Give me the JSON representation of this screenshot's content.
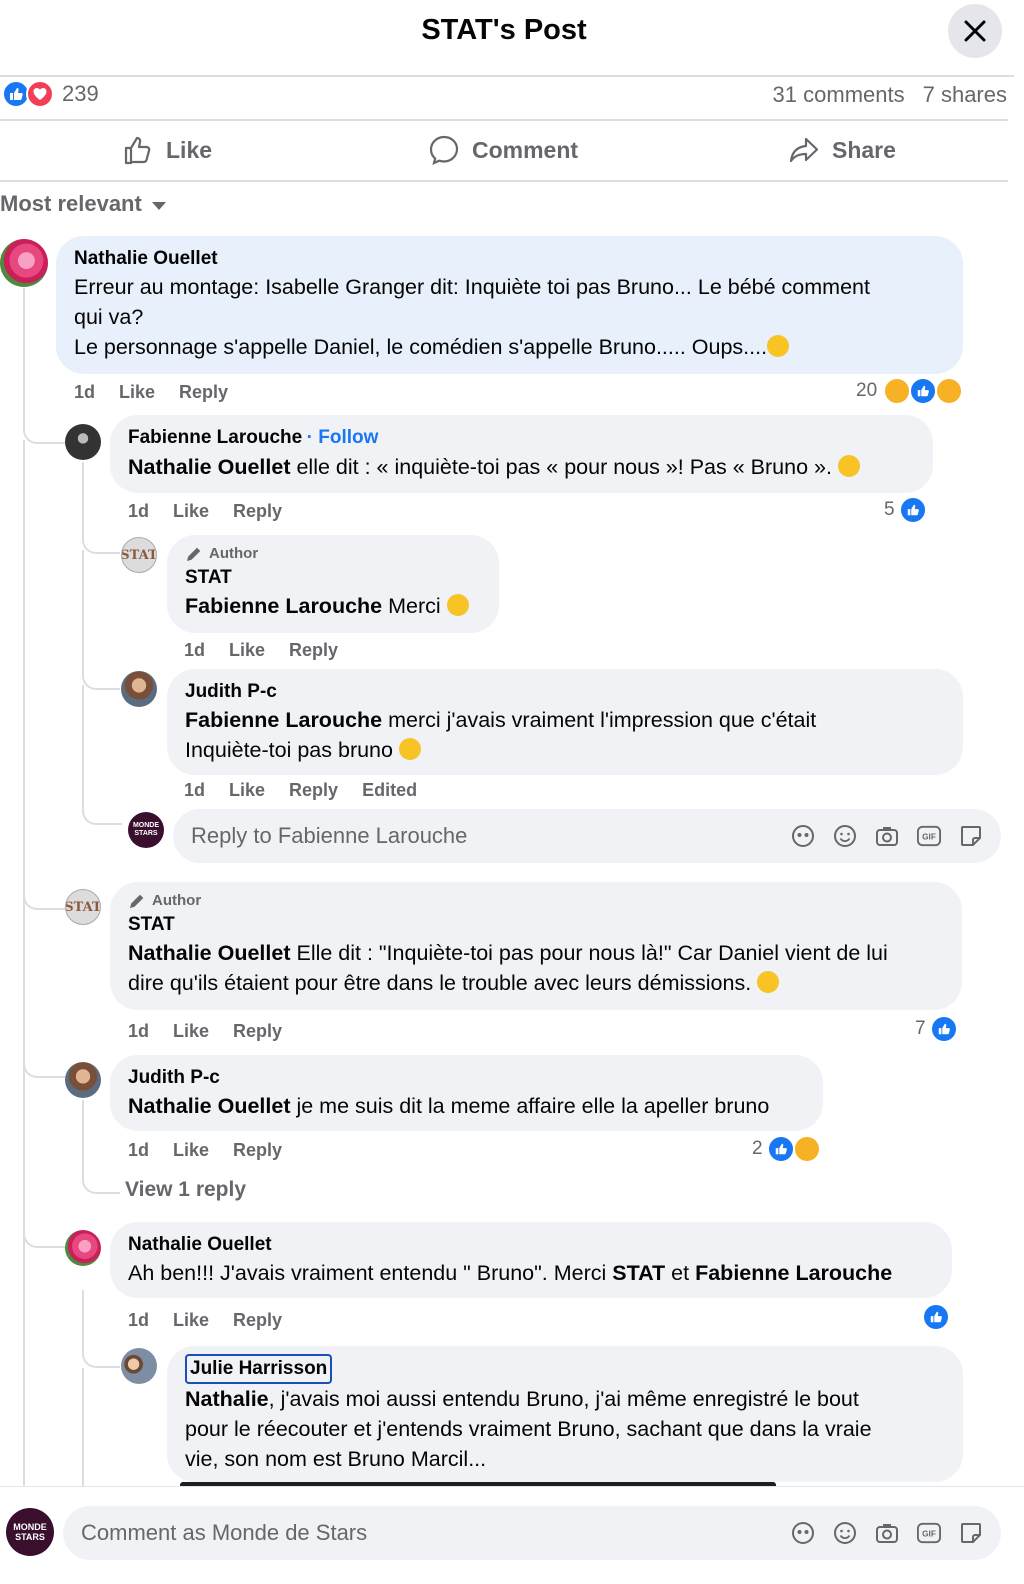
{
  "header": {
    "title": "STAT's Post"
  },
  "stats": {
    "reactions": "239",
    "comments": "31 comments",
    "shares": "7 shares"
  },
  "actions": {
    "like": "Like",
    "comment": "Comment",
    "share": "Share"
  },
  "sort": {
    "label": "Most relevant"
  },
  "colors": {
    "accent": "#1877f2",
    "bubble": "#f0f2f5",
    "bubble_highlight": "#e7f0fb",
    "secondary_text": "#65676b",
    "love": "#f33e58"
  },
  "comments": [
    {
      "author": "Nathalie Ouellet",
      "text1": "Erreur au montage: Isabelle Granger dit: Inquiète toi pas Bruno... Le bébé comment",
      "text2": "qui va?",
      "text3": "Le personnage s'appelle Daniel, le comédien s'appelle Bruno..... Oups....",
      "time": "1d",
      "like": "Like",
      "reply": "Reply",
      "reaction_count": "20"
    },
    {
      "author": "Fabienne Larouche",
      "follow": "· Follow",
      "mention": "Nathalie Ouellet",
      "text": " elle dit : « inquiète-toi pas « pour nous »! Pas « Bruno ».",
      "time": "1d",
      "like": "Like",
      "reply": "Reply",
      "reaction_count": "5"
    },
    {
      "badge": "Author",
      "author": "STAT",
      "mention": "Fabienne Larouche",
      "text": " Merci",
      "time": "1d",
      "like": "Like",
      "reply": "Reply"
    },
    {
      "author": "Judith P-c",
      "mention": "Fabienne Larouche",
      "text1": " merci j'avais vraiment l'impression que c'était",
      "text2": "Inquiète-toi pas bruno",
      "time": "1d",
      "like": "Like",
      "reply": "Reply",
      "edited": "Edited"
    },
    {
      "badge": "Author",
      "author": "STAT",
      "mention": "Nathalie Ouellet",
      "text1": " Elle dit : \"Inquiète-toi pas pour nous là!\" Car Daniel vient de lui",
      "text2": "dire qu'ils étaient pour être dans le trouble avec leurs démissions.",
      "time": "1d",
      "like": "Like",
      "reply": "Reply",
      "reaction_count": "7"
    },
    {
      "author": "Judith P-c",
      "mention": "Nathalie Ouellet",
      "text": " je me suis dit la meme affaire elle la apeller bruno",
      "time": "1d",
      "like": "Like",
      "reply": "Reply",
      "reaction_count": "2",
      "view_replies": "View 1 reply"
    },
    {
      "author": "Nathalie Ouellet",
      "text_a": "Ah ben!!! J'avais vraiment entendu \" Bruno\". Merci ",
      "mention1": "STAT",
      "text_b": " et ",
      "mention2": "Fabienne Larouche",
      "time": "1d",
      "like": "Like",
      "reply": "Reply"
    },
    {
      "author": "Julie Harrisson",
      "mention": "Nathalie",
      "text1": ", j'avais moi aussi entendu Bruno, j'ai même enregistré le bout",
      "text2": "pour le réecouter et j'entends vraiment Bruno, sachant que dans la vraie",
      "text3": "vie, son nom est Bruno Marcil..."
    }
  ],
  "reply_box": {
    "placeholder": "Reply to Fabienne Larouche",
    "avatar_text": "MONDE STARS"
  },
  "comment_box": {
    "placeholder": "Comment as Monde de Stars",
    "avatar_text": "MONDE STARS"
  },
  "icons": [
    "close-icon",
    "like-icon",
    "love-icon",
    "thumbs-up-icon",
    "comment-icon",
    "share-icon",
    "caret-down-icon",
    "pencil-icon",
    "avatar-icon",
    "sticker-icon",
    "emoji-icon",
    "camera-icon",
    "gif-icon",
    "sticker-face-icon"
  ]
}
